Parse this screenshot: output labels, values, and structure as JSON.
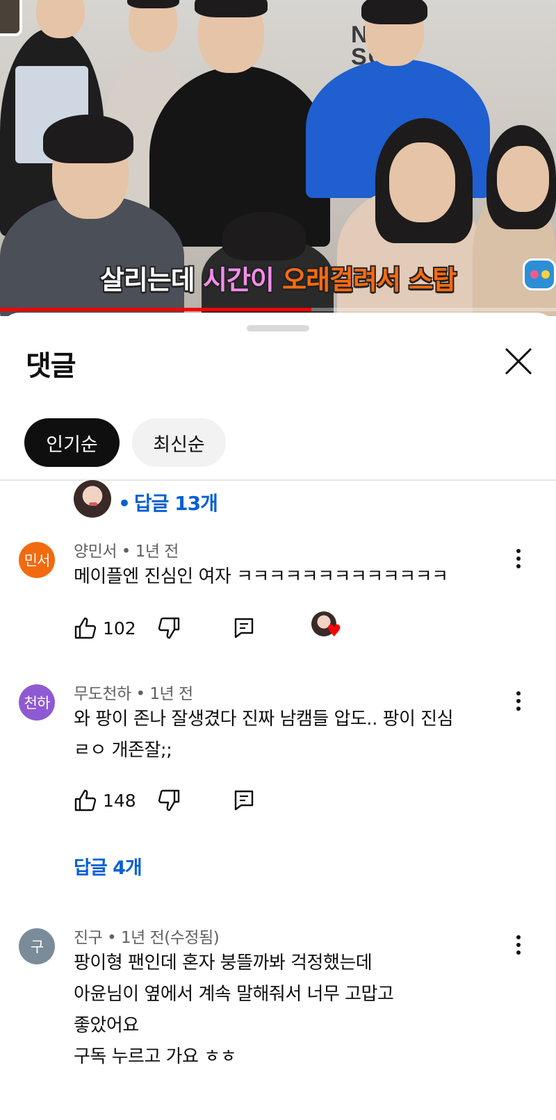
{
  "video": {
    "wall_text": [
      "NA",
      "SO N"
    ],
    "caption": {
      "part1": "살리는데 ",
      "part2": "시간이 ",
      "part3": "오래걸려서 스탑"
    },
    "progress_fraction": 0.56,
    "colors": {
      "progress": "#ff0000",
      "caption_highlight_pink": "#f28ee9",
      "caption_highlight_orange": "#ff6a10"
    }
  },
  "sheet": {
    "title": "댓글",
    "close_icon": "close-icon",
    "chips": [
      {
        "label": "인기순",
        "active": true
      },
      {
        "label": "최신순",
        "active": false
      }
    ]
  },
  "prev_comment": {
    "replies_label": "답글 13개",
    "dot": "•"
  },
  "comments": [
    {
      "avatar_text": "민서",
      "avatar_color": "#f26a0f",
      "author": "양민서",
      "time": "1년 전",
      "lines": [
        "메이플엔 진심인 여자 ㅋㅋㅋㅋㅋㅋㅋㅋㅋㅋㅋㅋㅋ"
      ],
      "likes": "102",
      "creator_heart": true
    },
    {
      "avatar_text": "천하",
      "avatar_color": "#8e5ad3",
      "author": "무도천하",
      "time": "1년 전",
      "lines": [
        "와 팡이 존나 잘생겼다 진짜 남캠들 압도.. 팡이 진심",
        "ㄹㅇ 개존잘;;"
      ],
      "likes": "148",
      "replies_label": "답글 4개"
    },
    {
      "avatar_text": "구",
      "avatar_color": "#7a8c99",
      "author": "진구",
      "time": "1년 전(수정됨)",
      "lines": [
        "팡이형 팬인데 혼자 붕뜰까봐 걱정했는데",
        "아윤님이 옆에서 계속 말해줘서 너무 고맙고",
        "좋았어요",
        "구독 누르고 가요 ㅎㅎ"
      ]
    }
  ],
  "icons": {
    "like": "thumbs-up-icon",
    "dislike": "thumbs-down-icon",
    "reply": "comment-reply-icon",
    "more": "more-vertical-icon",
    "heart": "creator-heart-icon"
  }
}
